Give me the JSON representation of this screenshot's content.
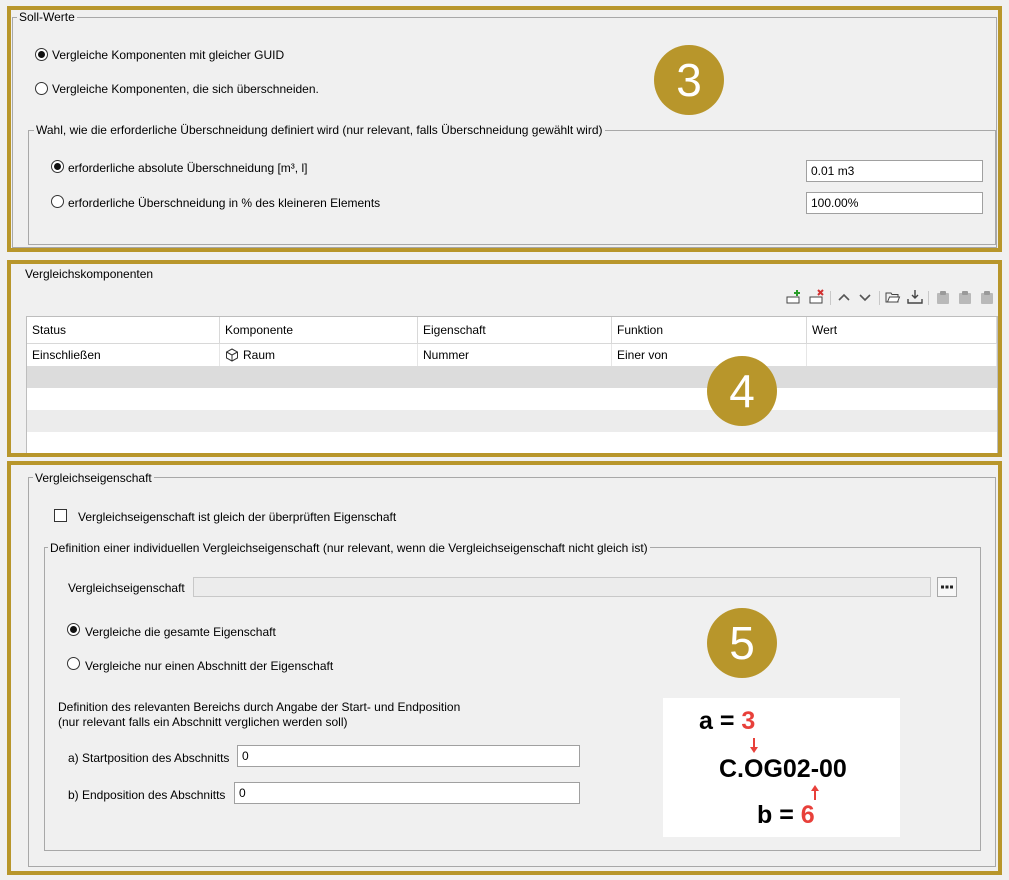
{
  "soll": {
    "title": "Soll-Werte",
    "radio_guid": "Vergleiche Komponenten mit gleicher GUID",
    "radio_overlap": "Vergleiche Komponenten, die sich überschneiden.",
    "overlap_group": {
      "title": "Wahl, wie die erforderliche Überschneidung definiert wird (nur relevant, falls Überschneidung gewählt wird)",
      "abs_label": "erforderliche absolute Überschneidung [m³, l]",
      "abs_value": "0.01 m3",
      "pct_label": "erforderliche Überschneidung in % des kleineren Elements",
      "pct_value": "100.00%"
    }
  },
  "badges": {
    "b3": "3",
    "b4": "4",
    "b5": "5"
  },
  "vergleich": {
    "title": "Vergleichskomponenten",
    "columns": [
      "Status",
      "Komponente",
      "Eigenschaft",
      "Funktion",
      "Wert"
    ],
    "rows": [
      {
        "status": "Einschließen",
        "komponente": "Raum",
        "eigenschaft": "Nummer",
        "funktion": "Einer von",
        "wert": ""
      }
    ]
  },
  "eig": {
    "title": "Vergleichseigenschaft",
    "checkbox_label": "Vergleichseigenschaft ist gleich der überprüften Eigenschaft",
    "def_group_title": "Definition einer individuellen Vergleichseigenschaft (nur relevant, wenn die Vergleichseigenschaft nicht gleich ist)",
    "field_label": "Vergleichseigenschaft",
    "field_value": "",
    "browse_label": "...",
    "radio_whole": "Vergleiche die gesamte Eigenschaft",
    "radio_section": "Vergleiche nur einen Abschnitt der Eigenschaft",
    "range_line1": "Definition des relevanten Bereichs durch Angabe der Start- und Endposition",
    "range_line2": "(nur relevant falls ein Abschnitt verglichen werden soll)",
    "start_label": "a) Startposition des Abschnitts",
    "start_value": "0",
    "end_label": "b) Endposition des Abschnitts",
    "end_value": "0"
  },
  "example": {
    "a_prefix": "a = ",
    "a_value": "3",
    "code": "C.OG02-00",
    "b_prefix": "b = ",
    "b_value": "6"
  },
  "colors": {
    "gold": "#b8962b",
    "red": "#e8403a"
  }
}
